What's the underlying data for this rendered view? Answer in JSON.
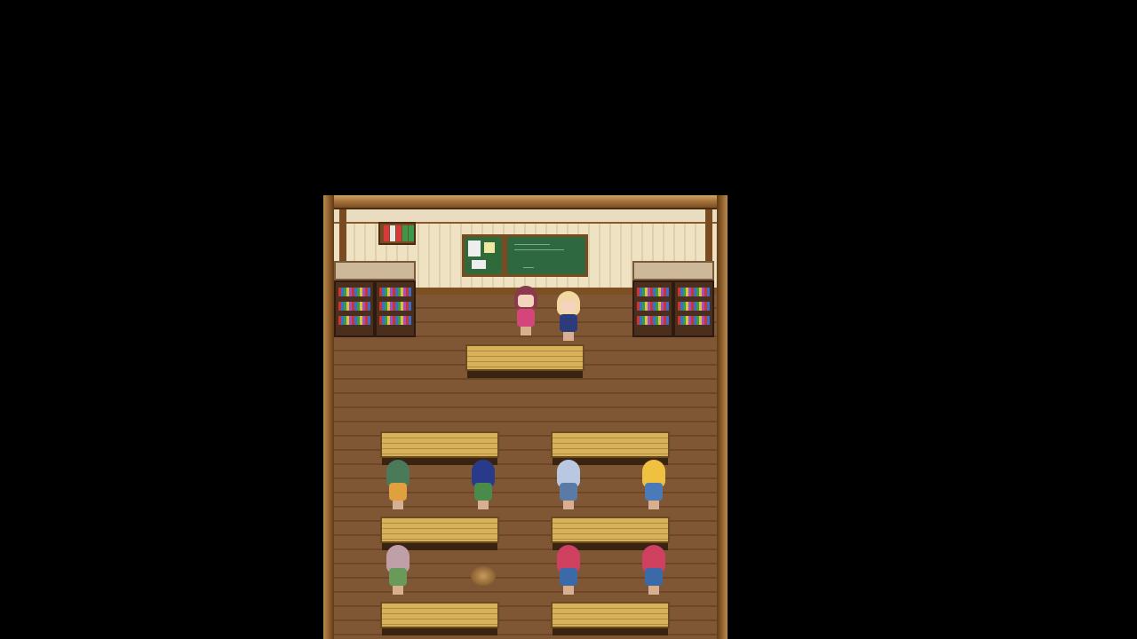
{
  "scene": {
    "name": "classroom",
    "palette": {
      "background": "#000000",
      "frame": "#a8763e",
      "wall": "#efe2c2",
      "floor": "#7f5734",
      "desk": "#d8b25a",
      "chalkboard": "#2e6840"
    },
    "chalkboard_text": "",
    "characters": [
      {
        "id": "teacher",
        "facing": "front",
        "hair": "#8a3a4a",
        "outfit": "#d4457a"
      },
      {
        "id": "blonde-student-front",
        "facing": "front",
        "hair": "#f0d8a0",
        "outfit": "#2c3c7a"
      },
      {
        "id": "green-hair-student",
        "facing": "back",
        "hair": "#4a7a5a",
        "outfit": "#e0a040"
      },
      {
        "id": "blue-hair-student",
        "facing": "back",
        "hair": "#2a3a8a",
        "outfit": "#4a8a4a"
      },
      {
        "id": "silver-hair-student",
        "facing": "back",
        "hair": "#b8c8e0",
        "outfit": "#5a7aa8"
      },
      {
        "id": "blonde-pigtails-student",
        "facing": "back",
        "hair": "#f0c040",
        "outfit": "#4a7ab8"
      },
      {
        "id": "pink-gray-hair-student",
        "facing": "back",
        "hair": "#c0a0a8",
        "outfit": "#6a9a5a"
      },
      {
        "id": "red-hair-student-left",
        "facing": "back",
        "hair": "#d04060",
        "outfit": "#3a6aa8"
      },
      {
        "id": "red-hair-student-right",
        "facing": "back",
        "hair": "#d04060",
        "outfit": "#3a6aa8"
      }
    ]
  }
}
